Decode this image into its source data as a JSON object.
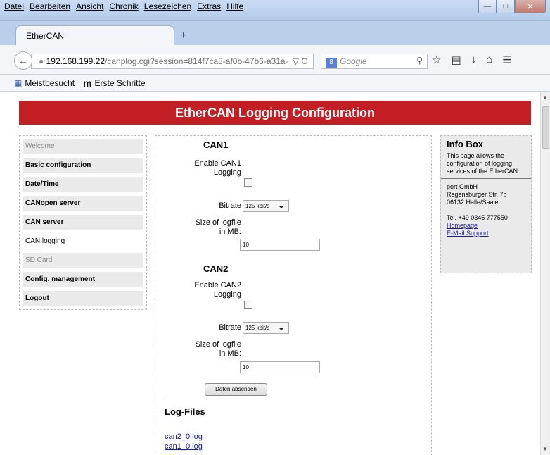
{
  "browser": {
    "menu": [
      "Datei",
      "Bearbeiten",
      "Ansicht",
      "Chronik",
      "Lesezeichen",
      "Extras",
      "Hilfe"
    ],
    "tab_title": "EtherCAN",
    "url_host": "192.168.199.22",
    "url_rest": "/canplog.cgi?session=814f7ca8-af0b-47b6-a31a-",
    "search_placeholder": "Google",
    "bookmarks": [
      "Meistbesucht",
      "Erste Schritte"
    ]
  },
  "page": {
    "title": "EtherCAN Logging Configuration"
  },
  "sidebar": {
    "items": [
      {
        "label": "Welcome"
      },
      {
        "label": "Basic configuration"
      },
      {
        "label": "Date/Time"
      },
      {
        "label": "CANopen server"
      },
      {
        "label": "CAN server"
      },
      {
        "label": "CAN logging"
      },
      {
        "label": "SD Card"
      },
      {
        "label": "Config. management"
      },
      {
        "label": "Logout"
      }
    ]
  },
  "form": {
    "can1": {
      "heading": "CAN1",
      "enable_label": "Enable CAN1 Logging",
      "bitrate_label": "Bitrate",
      "bitrate_value": "125 kbit/s",
      "size_label": "Size of logfile in MB:",
      "size_value": "10"
    },
    "can2": {
      "heading": "CAN2",
      "enable_label": "Enable CAN2 Logging",
      "bitrate_label": "Bitrate",
      "bitrate_value": "125 kbit/s",
      "size_label": "Size of logfile in MB:",
      "size_value": "10"
    },
    "submit_label": "Daten absenden"
  },
  "logfiles": {
    "heading": "Log-Files",
    "files": [
      "can2_0.log",
      "can1_0.log"
    ]
  },
  "infobox": {
    "title": "Info Box",
    "description": "This page allows the configuration of logging services of the EtherCAN.",
    "company": "port GmbH",
    "street": "Regensburger Str. 7b",
    "city": "06132 Halle/Saale",
    "phone": "Tel. +49 0345 777550",
    "link_homepage": "Homepage",
    "link_support": "E-Mail Support"
  },
  "colors": {
    "header_bg": "#c41e25",
    "link": "#1a1aa6"
  }
}
